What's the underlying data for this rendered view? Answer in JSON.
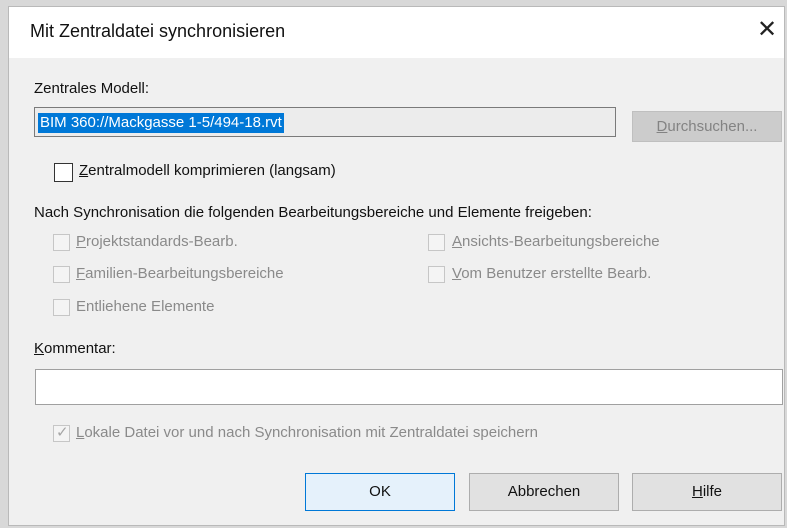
{
  "dialog": {
    "title": "Mit Zentraldatei synchronisieren",
    "close_symbol": "✕"
  },
  "central_model": {
    "label": "Zentrales Modell:",
    "path": "BIM 360://Mackgasse 1-5/494-18.rvt",
    "browse_button": {
      "label_first": "D",
      "label_rest": "urchsuchen...",
      "enabled": false
    }
  },
  "compress": {
    "label_first": "Z",
    "label_rest": "entralmodell komprimieren (langsam)",
    "checked": false
  },
  "release_section": {
    "heading": "Nach Synchronisation die folgenden Bearbeitungsbereiche und Elemente freigeben:",
    "items": [
      {
        "label_first": "P",
        "label_rest": "rojektstandards-Bearb.",
        "checked": false,
        "enabled": false
      },
      {
        "label_first": "F",
        "label_rest": "amilien-Bearbeitungsbereiche",
        "checked": false,
        "enabled": false
      },
      {
        "label": "Entliehene Elemente",
        "checked": false,
        "enabled": false
      },
      {
        "label_first": "A",
        "label_rest": "nsichts-Bearbeitungsbereiche",
        "checked": false,
        "enabled": false
      },
      {
        "label_first": "V",
        "label_rest": "om Benutzer erstellte Bearb.",
        "checked": false,
        "enabled": false
      }
    ]
  },
  "comment": {
    "label_first": "K",
    "label_rest": "ommentar:",
    "value": ""
  },
  "save_local": {
    "label_first": "L",
    "label_rest": "okale Datei vor und nach Synchronisation mit Zentraldatei speichern",
    "checkmark": "✓",
    "checked": true,
    "enabled": false
  },
  "buttons": {
    "ok": "OK",
    "cancel": "Abbrechen",
    "help_first": "H",
    "help_rest": "ilfe"
  },
  "colors": {
    "selection": "#0078d7",
    "dialog_bg": "#f0f0f0",
    "disabled_text": "#8a8a8a"
  }
}
